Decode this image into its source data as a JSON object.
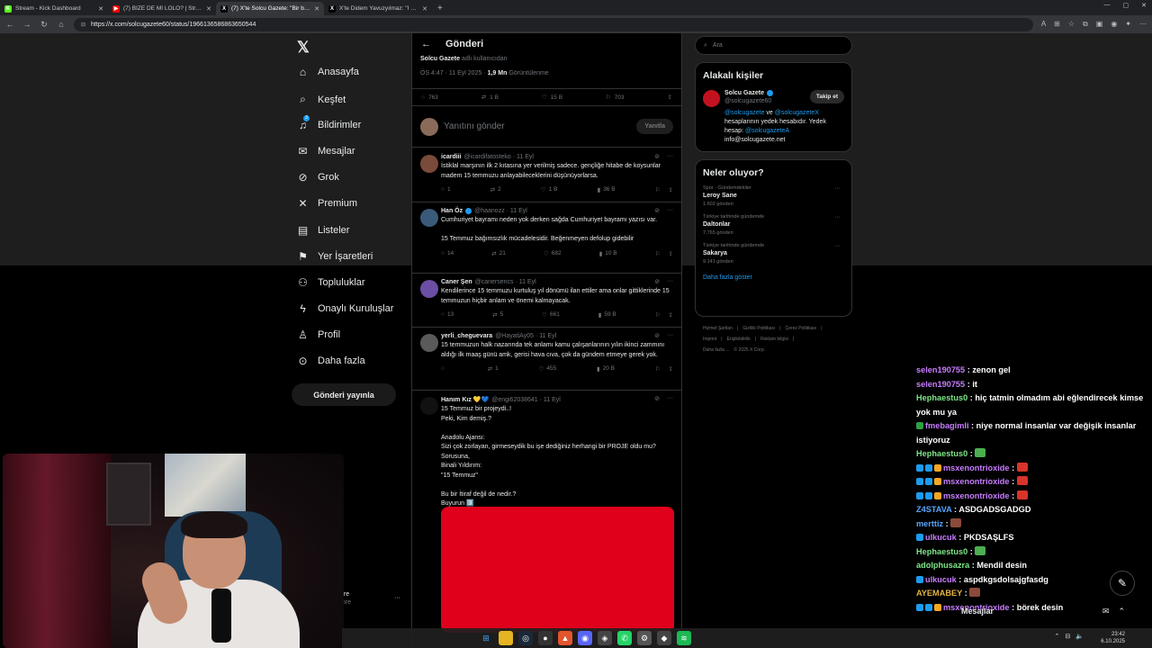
{
  "browser": {
    "tabs": [
      {
        "label": "Stream - Kick Dashboard",
        "color": "#53fc18",
        "glyph": "K",
        "active": false
      },
      {
        "label": "(7) BİZE DE Mİ LOLO? | Striders |",
        "color": "#ff0000",
        "glyph": "▶",
        "active": false
      },
      {
        "label": "(7) X'te Solcu Gazete: \"Bir baba, ke",
        "color": "#000000",
        "glyph": "X",
        "active": true
      },
      {
        "label": "X'te Didem Yavuzyılmaz: \"İ MİLLİ",
        "color": "#000000",
        "glyph": "X",
        "active": false
      }
    ],
    "url": "https://x.com/solcugazete60/status/1966136586863650544"
  },
  "nav": {
    "items": [
      {
        "label": "Anasayfa",
        "icon": "home-icon",
        "glyph": "⌂"
      },
      {
        "label": "Keşfet",
        "icon": "search-icon",
        "glyph": "⌕"
      },
      {
        "label": "Bildirimler",
        "icon": "bell-icon",
        "glyph": "♫",
        "badge": "3"
      },
      {
        "label": "Mesajlar",
        "icon": "mail-icon",
        "glyph": "✉"
      },
      {
        "label": "Grok",
        "icon": "grok-icon",
        "glyph": "⊘"
      },
      {
        "label": "Premium",
        "icon": "x-premium-icon",
        "glyph": "✕"
      },
      {
        "label": "Listeler",
        "icon": "list-icon",
        "glyph": "▤"
      },
      {
        "label": "Yer İşaretleri",
        "icon": "bookmark-icon",
        "glyph": "⚑"
      },
      {
        "label": "Topluluklar",
        "icon": "communities-icon",
        "glyph": "⚇"
      },
      {
        "label": "Onaylı Kuruluşlar",
        "icon": "lightning-icon",
        "glyph": "ϟ"
      },
      {
        "label": "Profil",
        "icon": "person-icon",
        "glyph": "♙"
      },
      {
        "label": "Daha fazla",
        "icon": "more-circle-icon",
        "glyph": "⊙"
      }
    ],
    "post_button": "Gönderi yayınla",
    "profile_name": "nre",
    "profile_handle": "mre"
  },
  "main": {
    "header": "Gönderi",
    "byline_user": "Solcu Gazete",
    "byline_rest": "adlı kullanıcıdan",
    "meta_time": "ÖS 4:47 · 11 Eyl 2025 ·",
    "meta_views": "1,9 Mn",
    "meta_views_label": "Görüntülenme",
    "stats": {
      "replies": "763",
      "reposts": "1 B",
      "likes": "15 B",
      "bookmarks": "703"
    },
    "reply_placeholder": "Yanıtını gönder",
    "reply_button": "Yanıtla",
    "replies": [
      {
        "name": "icardiii",
        "handle": "@icardifatosteko · 11 Eyl",
        "verified": false,
        "color": "#7a4b3a",
        "text": "İstiklal marşının ilk 2 kıtasına yer verilmiş sadece. gençliğe hitabe de koysunlar madem 15 temmuzu anlayabileceklerini düşünüyorlarsa.",
        "stats": {
          "replies": "1",
          "reposts": "2",
          "likes": "1 B",
          "views": "36 B"
        }
      },
      {
        "name": "Han Öz",
        "handle": "@haanozz · 11 Eyl",
        "verified": true,
        "color": "#3a5a7a",
        "text": "Cumhuriyet bayramı neden yok derken sağda Cumhuriyet bayramı yazısı var.\n\n15 Temmuz bağımsızlık mücadelesidir. Beğenmeyen defolup gidebilir",
        "stats": {
          "replies": "14",
          "reposts": "21",
          "likes": "682",
          "views": "10 B"
        }
      },
      {
        "name": "Caner Şen",
        "handle": "@canersencs · 11 Eyl",
        "verified": false,
        "color": "#6b4fa5",
        "text": "Kendilerince 15 temmuzu kurtuluş yıl dönümü ilan ettiler ama onlar gittiklerinde 15 temmuzun hiçbir anlam ve önemi kalmayacak.",
        "stats": {
          "replies": "13",
          "reposts": "5",
          "likes": "661",
          "views": "59 B"
        }
      },
      {
        "name": "yerli_cheguevara",
        "handle": "@HayatiAy05 · 11 Eyl",
        "verified": false,
        "color": "#5a5a5a",
        "text": "15 temmuzun halk nazarında tek anlamı kamu çalışanlarının yılın ikinci zammını aldığı ilk maaş günü amk, gerisi hava cıva, çok da gündem etmeye gerek yok.",
        "stats": {
          "replies": "",
          "reposts": "1",
          "likes": "455",
          "views": "20 B"
        }
      },
      {
        "name": "Hanım Kız 💛💙",
        "handle": "@engi62038641 · 11 Eyl",
        "verified": false,
        "color": "#111111",
        "text": "15 Temmuz bir projeydi..!\nPeki, Kim demiş.?\n\nAnadolu Ajansı:\nSizi çok zorlayan, girmeseydik bu işe dediğiniz herhangi bir PROJE oldu mu?\nSorusuna,\nBinali Yıldırım:\n\"15 Temmuz\"\n\nBu bir İtiraf değil de nedir.?\nBuyurun 3️⃣",
        "stats": {
          "replies": "",
          "reposts": "",
          "likes": "",
          "views": ""
        }
      }
    ]
  },
  "right": {
    "search_placeholder": "Ara",
    "related_title": "Alakalı kişiler",
    "person": {
      "name": "Solcu Gazete",
      "handle": "@solcugazete60",
      "follow": "Takip et",
      "bio_link1": "@solcugazete",
      "bio_mid": " ve ",
      "bio_link2": "@solcugazeteX",
      "bio_text": " hesaplarının yedek hesabıdır. Yedek hesap: ",
      "bio_link3": "@solcugazeteA",
      "bio_mail": "info@solcugazete.net"
    },
    "trends_title": "Neler oluyor?",
    "trends": [
      {
        "context": "Spor · Gündemdekiler",
        "name": "Leroy Sane",
        "count": "1.602 gönderi"
      },
      {
        "context": "Türkiye tarihinde gündemde",
        "name": "Daltonlar",
        "count": "7.765 gönderi"
      },
      {
        "context": "Türkiye tarihinde gündemde",
        "name": "Sakarya",
        "count": "9.141 gönderi"
      }
    ],
    "show_more": "Daha fazla göster",
    "footer": [
      "Hizmet Şartları",
      "|",
      "Gizlilik Politikası",
      "|",
      "Çerez Politikası",
      "|",
      "Imprint",
      "|",
      "Erişilebilirlik",
      "|",
      "Reklam bilgisi",
      "|",
      "Daha fazla ...",
      "© 2025 X Corp."
    ]
  },
  "chat": {
    "messages": [
      {
        "user": "selen190755",
        "color": "#c77dff",
        "text": "zenon gel",
        "badges": []
      },
      {
        "user": "selen190755",
        "color": "#c77dff",
        "text": "it",
        "badges": []
      },
      {
        "user": "Hephaestus0",
        "color": "#7ee787",
        "text": "hiç tatmin olmadım abi eğlendirecek kimse yok mu ya",
        "badges": []
      },
      {
        "user": "fmebagimli",
        "color": "#c77dff",
        "text": "niye normal insanlar var değişik insanlar istiyoruz",
        "badges": [
          "#2ea043"
        ]
      },
      {
        "user": "Hephaestus0",
        "color": "#7ee787",
        "text": "",
        "badges": [],
        "emote": "#4caf50"
      },
      {
        "user": "msxenontrioxide",
        "color": "#c77dff",
        "text": "",
        "badges": [
          "#1d9bf0",
          "#1d9bf0",
          "#f5a623"
        ],
        "emote": "#d9342b"
      },
      {
        "user": "msxenontrioxide",
        "color": "#c77dff",
        "text": "",
        "badges": [
          "#1d9bf0",
          "#1d9bf0",
          "#f5a623"
        ],
        "emote": "#d9342b"
      },
      {
        "user": "msxenontrioxide",
        "color": "#c77dff",
        "text": "",
        "badges": [
          "#1d9bf0",
          "#1d9bf0",
          "#f5a623"
        ],
        "emote": "#d9342b"
      },
      {
        "user": "Z4STAVA",
        "color": "#58a6ff",
        "text": "ASDGADSGADGD",
        "badges": []
      },
      {
        "user": "merttiz",
        "color": "#58a6ff",
        "text": "",
        "badges": [],
        "emote": "#8b4a3a"
      },
      {
        "user": "ulkucuk",
        "color": "#c77dff",
        "text": "PKDSAŞLFS",
        "badges": [
          "#1d9bf0"
        ]
      },
      {
        "user": "Hephaestus0",
        "color": "#7ee787",
        "text": "",
        "badges": [],
        "emote": "#4caf50"
      },
      {
        "user": "adolphusazra",
        "color": "#7ee787",
        "text": "Mendil desin",
        "badges": []
      },
      {
        "user": "ulkucuk",
        "color": "#c77dff",
        "text": "aspdkgsdolsajgfasdg",
        "badges": [
          "#1d9bf0"
        ]
      },
      {
        "user": "AYEMABEY",
        "color": "#e3b341",
        "text": "",
        "badges": [],
        "emote": "#8b4a3a"
      },
      {
        "user": "msxenontrioxide",
        "color": "#c77dff",
        "text": "börek desin",
        "badges": [
          "#1d9bf0",
          "#1d9bf0",
          "#f5a623"
        ]
      }
    ],
    "bar_label": "Mesajlar"
  },
  "taskbar": {
    "time": "23:42",
    "date": "6.10.2025"
  }
}
